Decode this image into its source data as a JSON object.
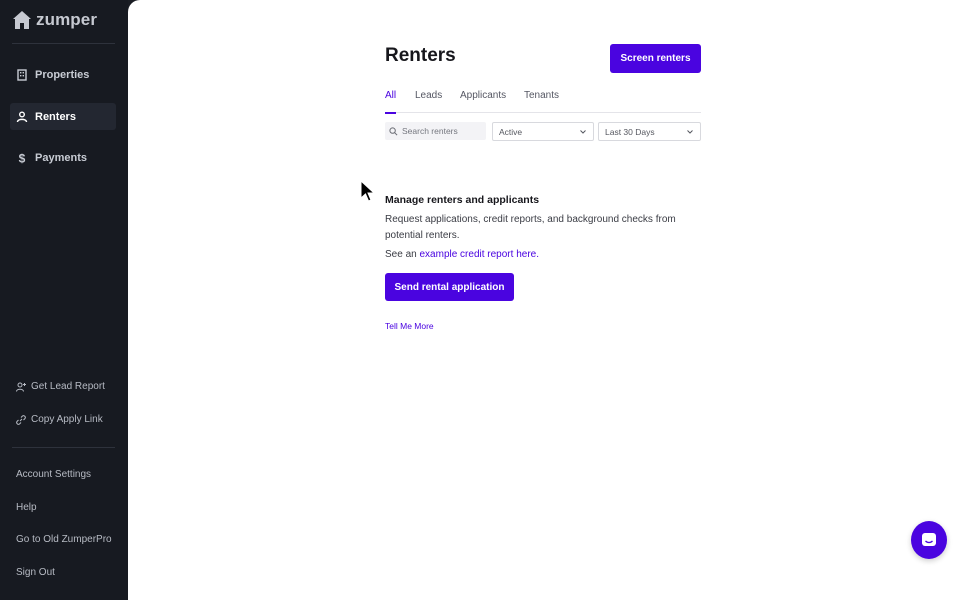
{
  "app": {
    "brand": "zumper"
  },
  "sidebar": {
    "nav": [
      {
        "label": "Properties",
        "icon": "building-icon",
        "active": false
      },
      {
        "label": "Renters",
        "icon": "person-icon",
        "active": true
      },
      {
        "label": "Payments",
        "icon": "dollar-icon",
        "active": false
      }
    ],
    "utilities": [
      {
        "label": "Get Lead Report",
        "icon": "person-plus-icon"
      },
      {
        "label": "Copy Apply Link",
        "icon": "link-icon"
      }
    ],
    "bottom_links": [
      "Account Settings",
      "Help",
      "Go to Old ZumperPro",
      "Sign Out"
    ]
  },
  "main": {
    "title": "Renters",
    "screen_button": "Screen renters",
    "tabs": [
      "All",
      "Leads",
      "Applicants",
      "Tenants"
    ],
    "active_tab": "All",
    "filters": {
      "search_placeholder": "Search renters",
      "status_value": "Active",
      "date_value": "Last 30 Days"
    },
    "empty_state": {
      "title": "Manage renters and applicants",
      "description": "Request applications, credit reports, and background checks from potential renters.",
      "example_prefix": "See an ",
      "example_link": "example credit report here.",
      "send_button": "Send rental application",
      "tell_more": "Tell Me More"
    }
  },
  "colors": {
    "accent": "#4a04e0",
    "sidebar_bg": "#171a21",
    "main_bg": "#ffffff"
  },
  "chat_widget": {
    "icon": "chat-icon"
  }
}
